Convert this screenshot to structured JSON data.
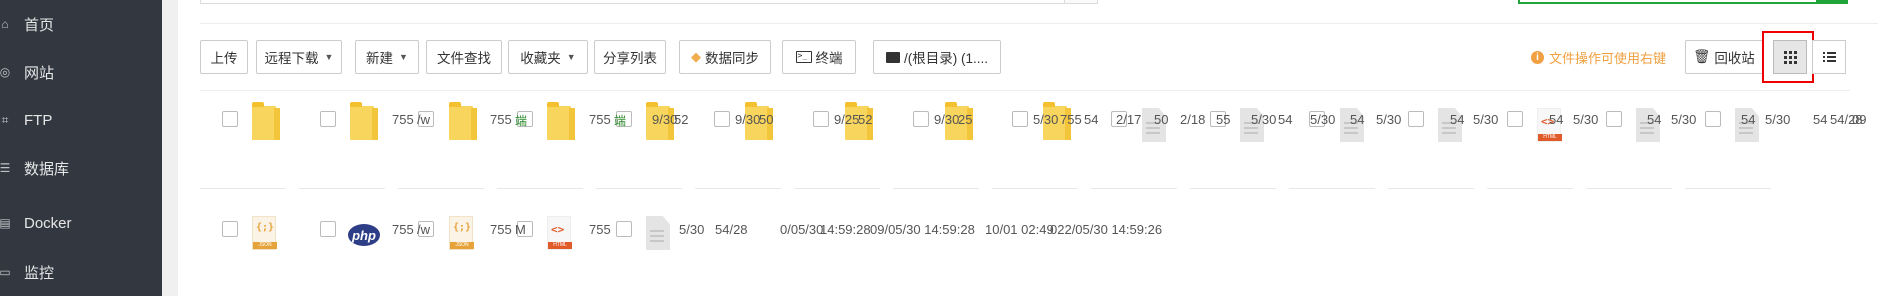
{
  "sidebar": {
    "items": [
      {
        "label": "首页",
        "icon": "home-icon"
      },
      {
        "label": "网站",
        "icon": "globe-icon"
      },
      {
        "label": "FTP",
        "icon": "ftp-icon"
      },
      {
        "label": "数据库",
        "icon": "database-icon"
      },
      {
        "label": "Docker",
        "icon": "docker-icon"
      },
      {
        "label": "监控",
        "icon": "monitor-icon"
      }
    ]
  },
  "toolbar": {
    "upload": "上传",
    "remote_download": "远程下载",
    "new": "新建",
    "file_search": "文件查找",
    "favorites": "收藏夹",
    "share_list": "分享列表",
    "data_sync": "数据同步",
    "terminal": "终端",
    "path": "/(根目录) (1....",
    "tip": "文件操作可使用右键",
    "recycle_bin": "回收站"
  },
  "files": {
    "row1_text": [
      "755",
      "/w",
      "755",
      "端",
      "755",
      "端",
      "9/30",
      "52",
      "9/30",
      "50",
      "9/25",
      "52",
      "9/30",
      "25",
      "5/30",
      "755",
      "54",
      "2/17",
      "50",
      "2/18",
      "55",
      "5/30",
      "54",
      "5/30",
      "54",
      "5/30",
      "54",
      "5/30",
      "54",
      "5/30",
      "54",
      "5/30",
      "54",
      "5/30",
      "54",
      "54/28",
      "09"
    ],
    "row2_text": [
      "755",
      "/w",
      "755",
      "M",
      "755",
      "5/30",
      "54/28",
      "0/05/30",
      "14:59:28",
      "09/05/30 14:59:28",
      "10/01 02:49",
      "022/05/30 14:59:26"
    ],
    "icon_tags": {
      "html": "HTML",
      "json": "JSON",
      "php": "php"
    }
  },
  "colors": {
    "sidebar_bg": "#333840",
    "accent_green": "#20a53a",
    "highlight_red": "#e00000",
    "tip_orange": "#f0a040"
  }
}
